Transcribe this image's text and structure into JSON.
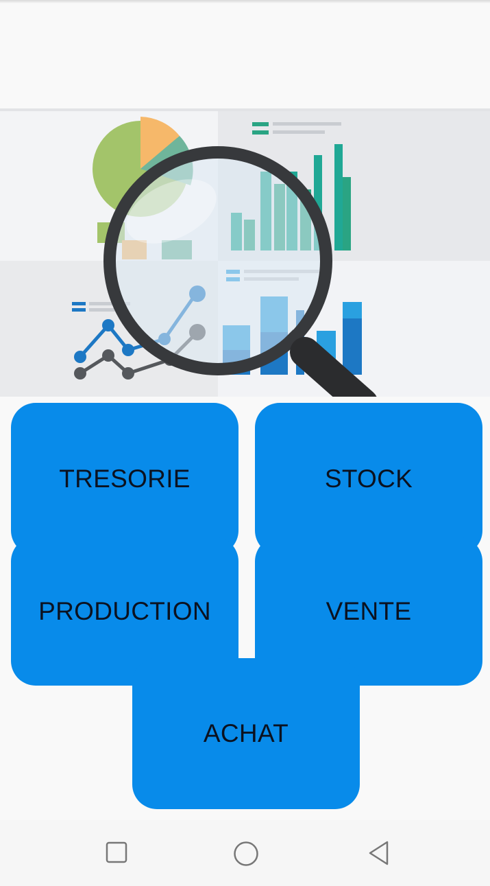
{
  "menu": {
    "tresorie": "TRESORIE",
    "stock": "STOCK",
    "production": "PRODUCTION",
    "vente": "VENTE",
    "achat": "ACHAT"
  },
  "banner": {
    "icon": "analytics-magnifier-illustration"
  },
  "navigation": {
    "recent_icon": "square-icon",
    "home_icon": "circle-icon",
    "back_icon": "triangle-back-icon"
  },
  "colors": {
    "tile_background": "#088bea",
    "tile_text": "#0b1220",
    "page_background": "#f9f9f9"
  }
}
